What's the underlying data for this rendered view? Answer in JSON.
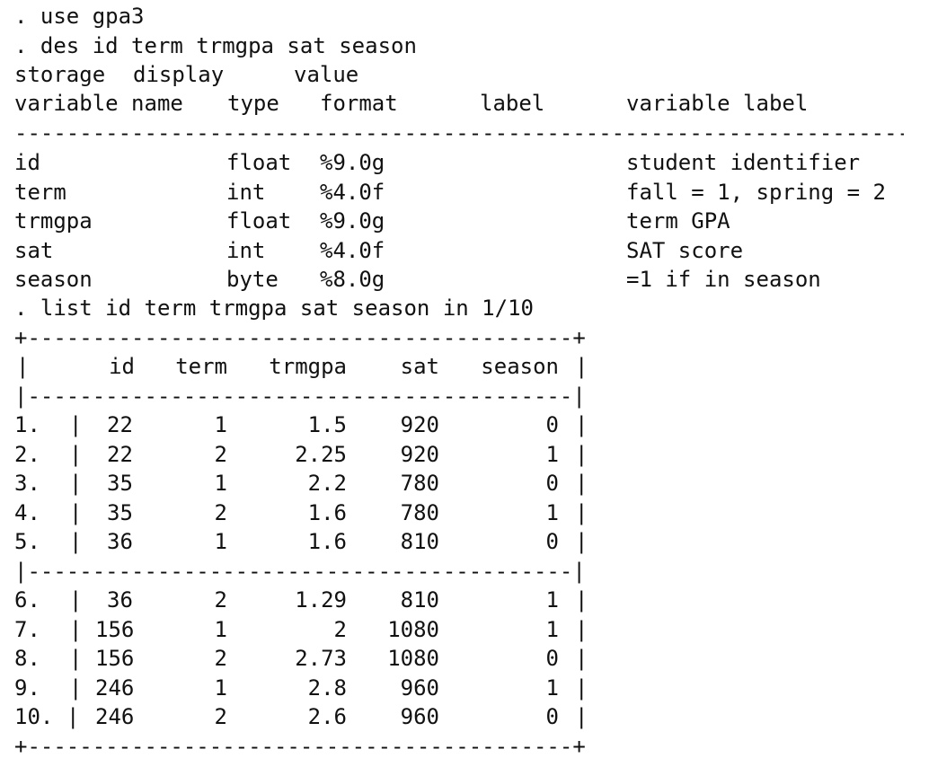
{
  "commands": {
    "use": ". use gpa3",
    "describe": ". des id term trmgpa sat season",
    "list": ". list id term trmgpa sat season in 1/10"
  },
  "describe": {
    "header_top": [
      "storage",
      "display",
      "value"
    ],
    "header_bottom": [
      "variable name",
      "type",
      "format",
      "label",
      "variable label"
    ],
    "rule": "-------------------------------------------------------------------------------",
    "variables": [
      {
        "name": "id",
        "type": "float",
        "format": "%9.0g",
        "label": "",
        "varlabel": "student identifier"
      },
      {
        "name": "term",
        "type": "int",
        "format": "%4.0f",
        "label": "",
        "varlabel": "fall = 1, spring = 2"
      },
      {
        "name": "trmgpa",
        "type": "float",
        "format": "%9.0g",
        "label": "",
        "varlabel": "term GPA"
      },
      {
        "name": "sat",
        "type": "int",
        "format": "%4.0f",
        "label": "",
        "varlabel": "SAT score"
      },
      {
        "name": "season",
        "type": "byte",
        "format": "%8.0g",
        "label": "",
        "varlabel": "=1 if in season"
      }
    ]
  },
  "list": {
    "border": "+------------------------------------------+",
    "divider": "|------------------------------------------|",
    "columns": [
      "id",
      "term",
      "trmgpa",
      "sat",
      "season"
    ],
    "rows": [
      {
        "n": "1.",
        "id": "22",
        "term": "1",
        "trmgpa": "1.5",
        "sat": "920",
        "season": "0"
      },
      {
        "n": "2.",
        "id": "22",
        "term": "2",
        "trmgpa": "2.25",
        "sat": "920",
        "season": "1"
      },
      {
        "n": "3.",
        "id": "35",
        "term": "1",
        "trmgpa": "2.2",
        "sat": "780",
        "season": "0"
      },
      {
        "n": "4.",
        "id": "35",
        "term": "2",
        "trmgpa": "1.6",
        "sat": "780",
        "season": "1"
      },
      {
        "n": "5.",
        "id": "36",
        "term": "1",
        "trmgpa": "1.6",
        "sat": "810",
        "season": "0"
      },
      {
        "n": "6.",
        "id": "36",
        "term": "2",
        "trmgpa": "1.29",
        "sat": "810",
        "season": "1"
      },
      {
        "n": "7.",
        "id": "156",
        "term": "1",
        "trmgpa": "2",
        "sat": "1080",
        "season": "1"
      },
      {
        "n": "8.",
        "id": "156",
        "term": "2",
        "trmgpa": "2.73",
        "sat": "1080",
        "season": "0"
      },
      {
        "n": "9.",
        "id": "246",
        "term": "1",
        "trmgpa": "2.8",
        "sat": "960",
        "season": "1"
      },
      {
        "n": "10.",
        "id": "246",
        "term": "2",
        "trmgpa": "2.6",
        "sat": "960",
        "season": "0"
      }
    ]
  }
}
